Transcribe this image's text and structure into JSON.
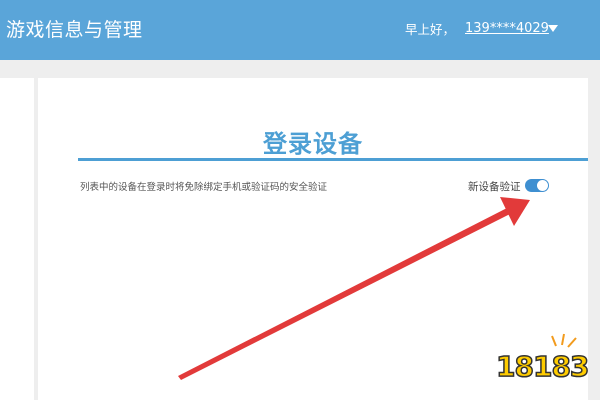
{
  "header": {
    "title": "游戏信息与管理",
    "greeting": "早上好，",
    "account": "139****4029"
  },
  "section": {
    "title": "登录设备",
    "description": "列表中的设备在登录时将免除绑定手机或验证码的安全验证",
    "toggle_label": "新设备验证",
    "toggle_on": true
  },
  "watermark": {
    "text": "18183"
  },
  "colors": {
    "header_bg": "#5aa5d9",
    "accent": "#4d9fd4",
    "toggle": "#3e8fd1",
    "arrow": "#e23a3a"
  }
}
